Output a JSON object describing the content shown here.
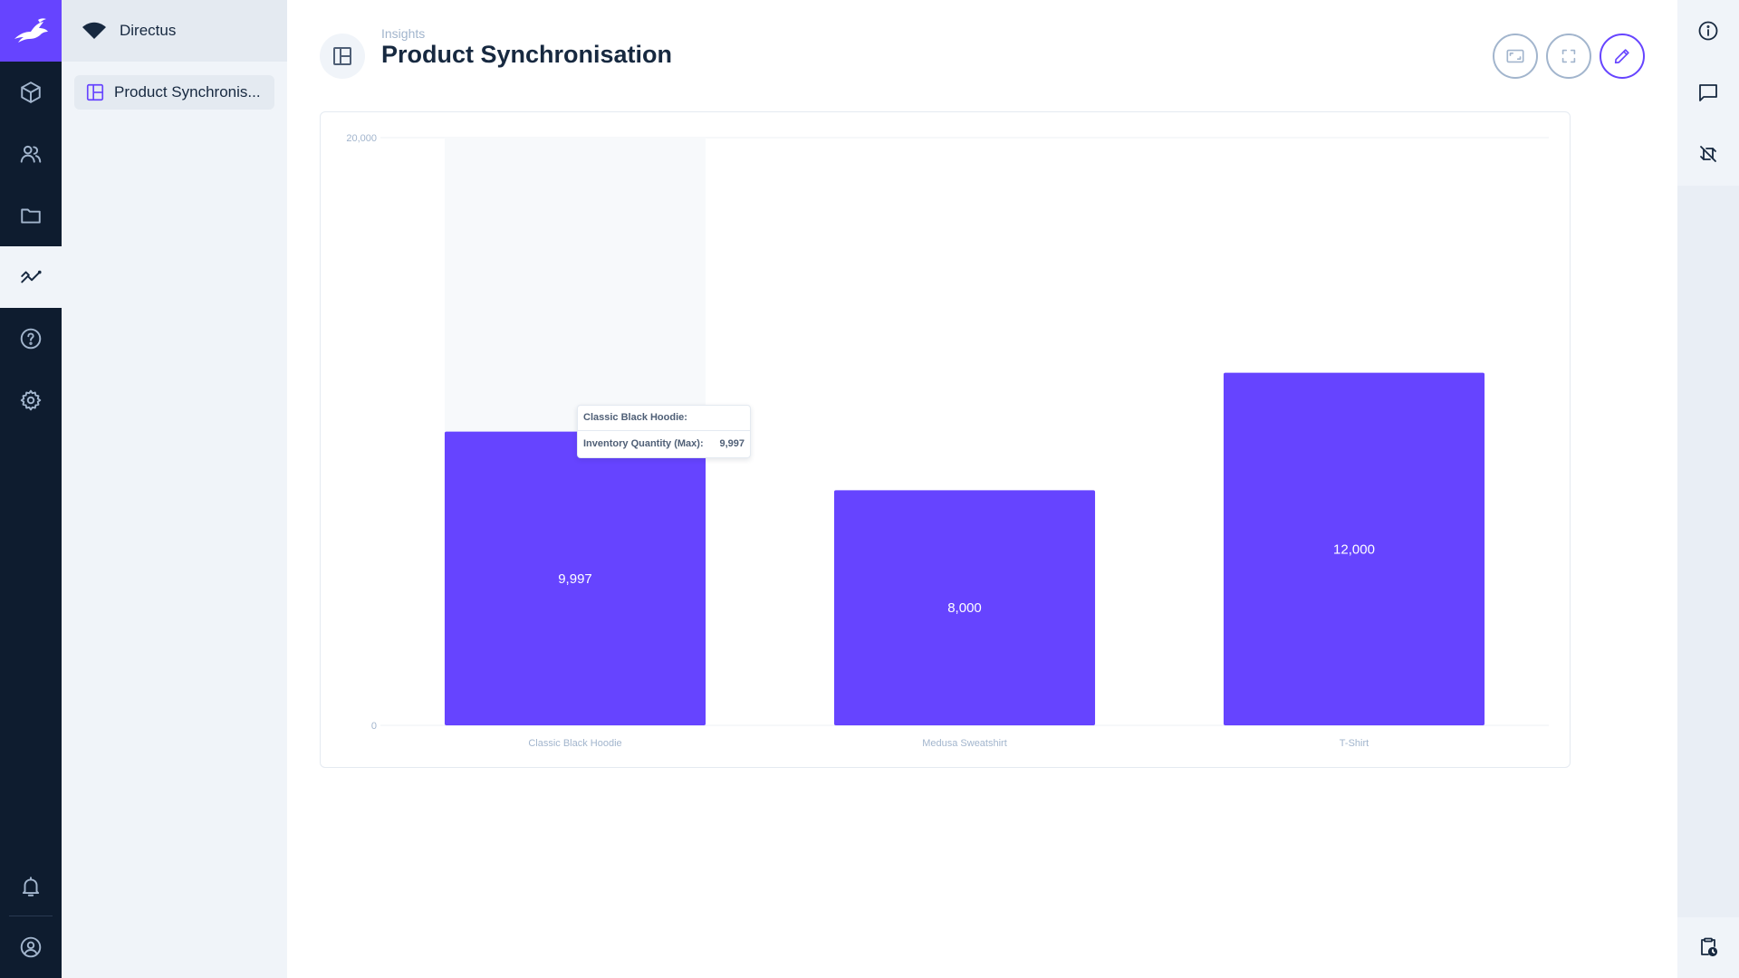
{
  "app": {
    "project_name": "Directus",
    "brand_color": "#6644ff"
  },
  "module_bar": {
    "items": [
      {
        "name": "content-module",
        "icon": "box-icon"
      },
      {
        "name": "user-directory-module",
        "icon": "people-icon"
      },
      {
        "name": "file-library-module",
        "icon": "folder-icon"
      },
      {
        "name": "insights-module",
        "icon": "insights-icon",
        "active": true
      },
      {
        "name": "help-module",
        "icon": "help-icon"
      },
      {
        "name": "settings-module",
        "icon": "gear-icon"
      }
    ],
    "bottom": [
      {
        "name": "notifications",
        "icon": "bell-icon"
      },
      {
        "name": "user-menu",
        "icon": "account-icon"
      }
    ]
  },
  "nav": {
    "items": [
      {
        "label": "Product Synchronis..."
      }
    ]
  },
  "header": {
    "breadcrumb": "Insights",
    "title": "Product Synchronisation"
  },
  "tooltip": {
    "title": "Classic Black Hoodie:",
    "label": "Inventory Quantity (Max):",
    "value": "9,997"
  },
  "chart_data": {
    "type": "bar",
    "categories": [
      "Classic Black Hoodie",
      "Medusa Sweatshirt",
      "T-Shirt"
    ],
    "values": [
      9997,
      8000,
      12000
    ],
    "data_labels": [
      "9,997",
      "8,000",
      "12,000"
    ],
    "y_ticks": [
      {
        "value": 0,
        "label": "0"
      },
      {
        "value": 20000,
        "label": "20,000"
      }
    ],
    "ylim": [
      0,
      20000
    ],
    "bar_color": "#6644ff",
    "hovered_index": 0,
    "grid": true
  }
}
